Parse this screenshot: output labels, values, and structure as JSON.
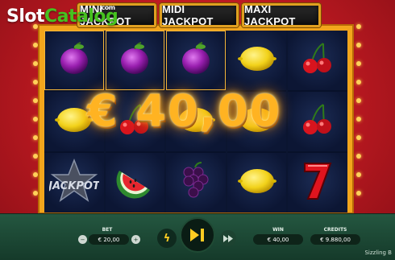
{
  "watermark": {
    "slot": "Slot",
    "catalog": "Catalog",
    "com": ".com"
  },
  "jackpots": {
    "mini": "MINI JACKPOT",
    "midi": "MIDI JACKPOT",
    "maxi": "MAXI JACKPOT"
  },
  "reels": [
    [
      "plum-icon",
      "lemon-icon",
      "jackpot-star-icon"
    ],
    [
      "plum-icon",
      "cherries-icon",
      "watermelon-icon"
    ],
    [
      "plum-icon",
      "lemon-icon",
      "grapes-icon"
    ],
    [
      "lemon-icon",
      "lemon-icon",
      "lemon-icon"
    ],
    [
      "cherries-icon",
      "cherries-icon",
      "seven-icon"
    ]
  ],
  "win": {
    "amount": "€ 40,00"
  },
  "controls": {
    "bet_label": "BET",
    "bet_value": "€ 20,00",
    "win_label": "WIN",
    "win_value": "€ 40,00",
    "credits_label": "CREDITS",
    "credits_value": "€ 9.880,00",
    "game_name": "Sizzling B"
  },
  "colors": {
    "frame": "#f2a51c",
    "background": "#c41e26",
    "bar": "#1f4a36",
    "accent": "#ffcc22"
  }
}
